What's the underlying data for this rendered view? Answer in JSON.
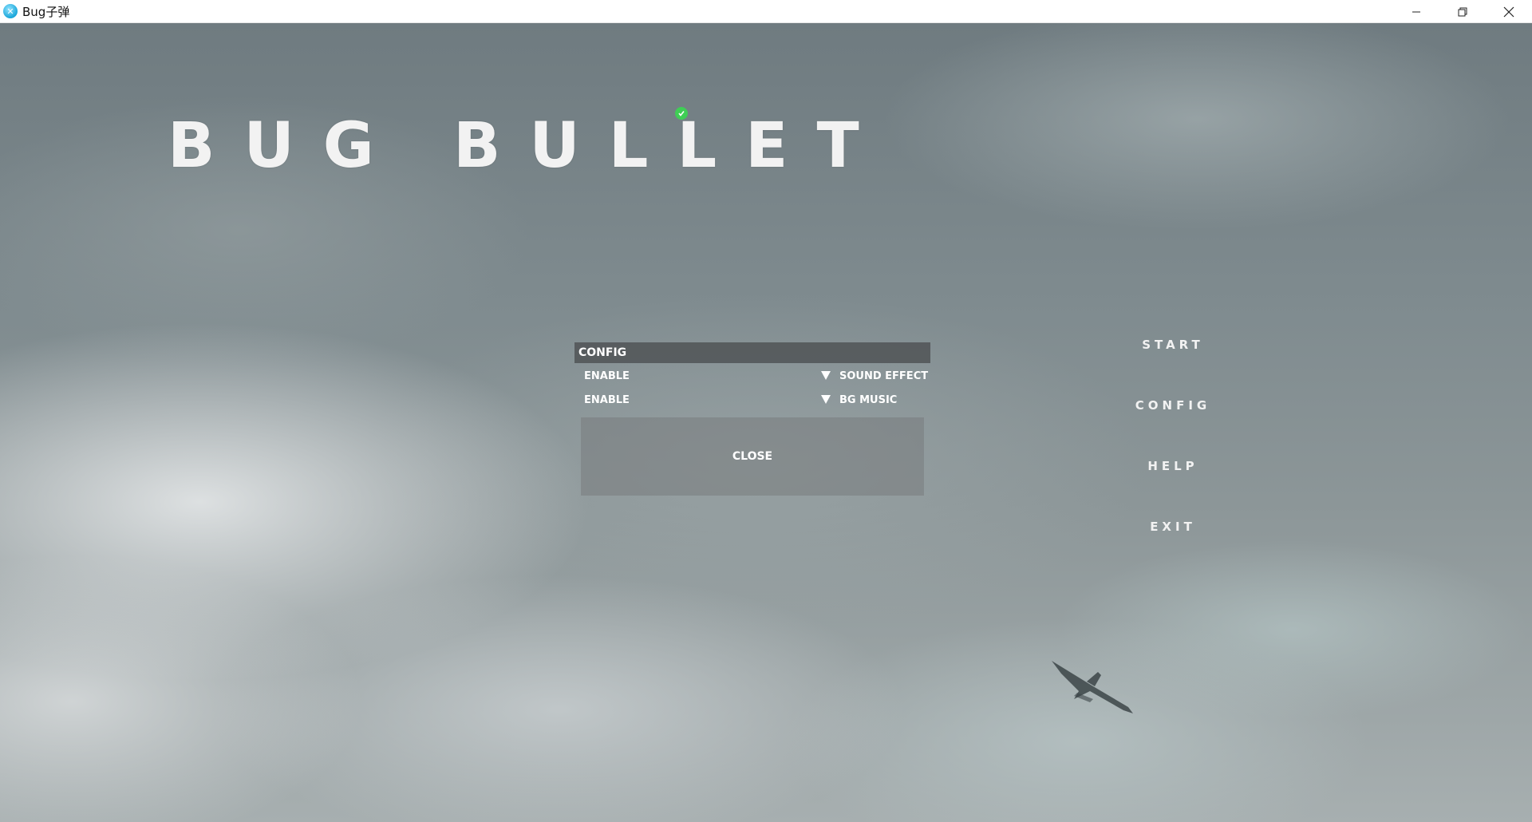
{
  "window": {
    "title": "Bug子弹",
    "icon": "app-logo-icon",
    "controls": [
      "minimize-icon",
      "restore-icon",
      "close-icon"
    ]
  },
  "game": {
    "title": "BUG BULLET",
    "badge_icon": "check-icon",
    "badge_color": "#3fce55"
  },
  "menu": {
    "items": [
      {
        "label": "START"
      },
      {
        "label": "CONFIG"
      },
      {
        "label": "HELP"
      },
      {
        "label": "EXIT"
      }
    ]
  },
  "config": {
    "header": "CONFIG",
    "rows": [
      {
        "value": "ENABLE",
        "label": "SOUND EFFECT"
      },
      {
        "value": "ENABLE",
        "label": "BG MUSIC"
      }
    ],
    "close_label": "CLOSE"
  }
}
